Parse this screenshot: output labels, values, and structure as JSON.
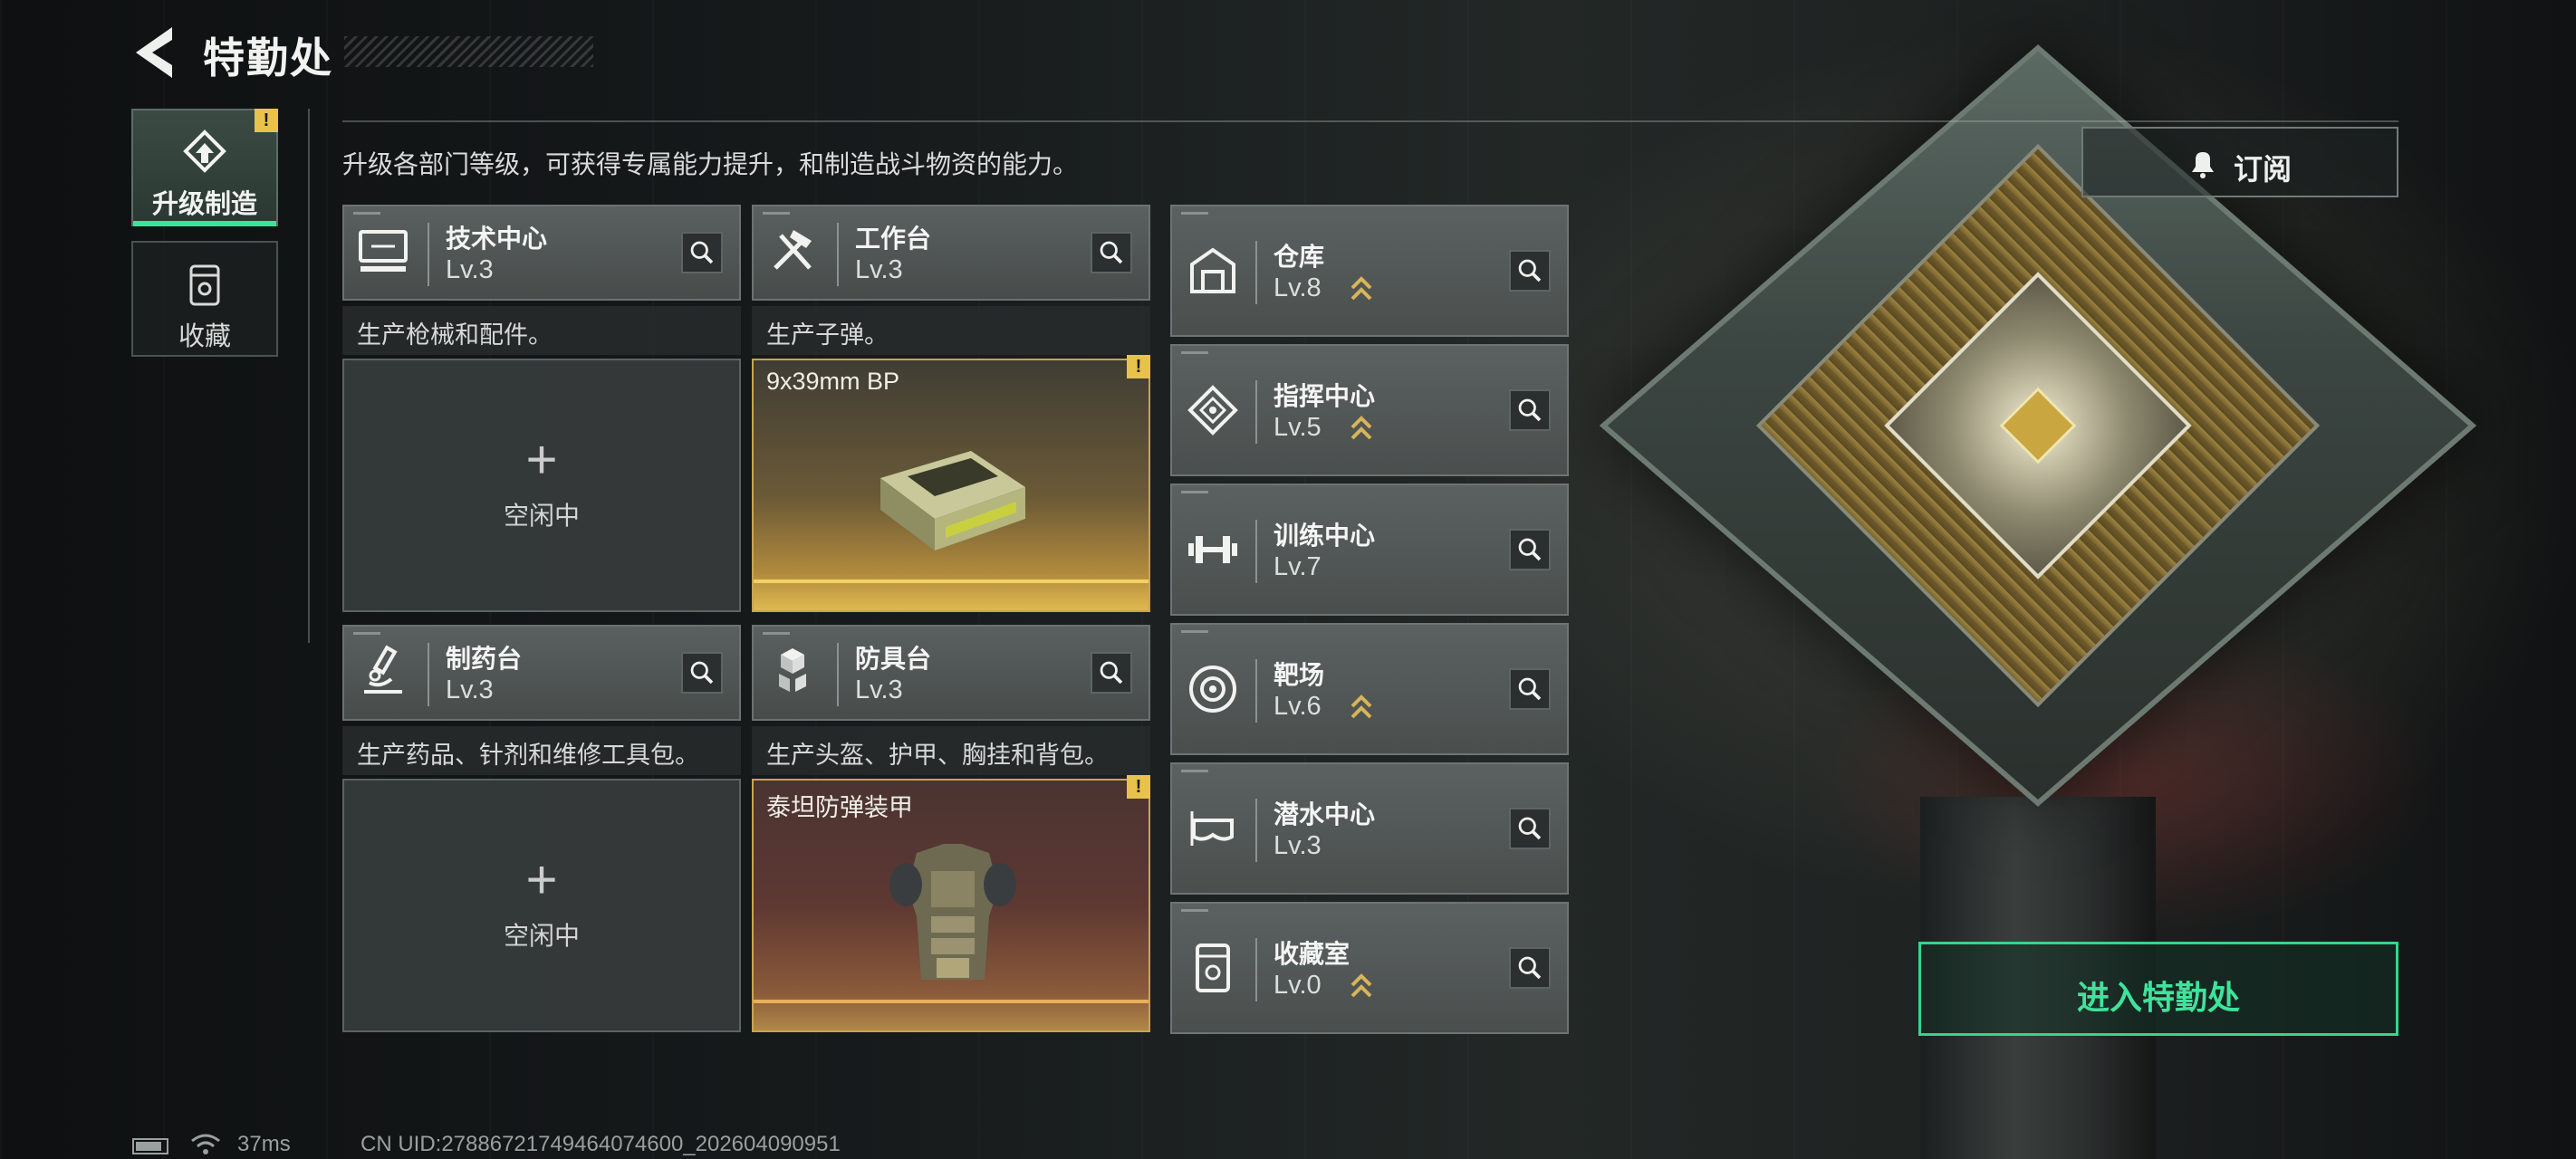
{
  "header": {
    "title": "特勤处"
  },
  "tabs": [
    {
      "label": "升级制造",
      "badge": "!",
      "active": true
    },
    {
      "label": "收藏",
      "active": false
    }
  ],
  "description": "升级各部门等级，可获得专属能力提升，和制造战斗物资的能力。",
  "facilities": [
    {
      "name": "技术中心",
      "level": "Lv.3",
      "desc": "生产枪械和配件。",
      "slot_status": "空闲中",
      "slot_plus": "+"
    },
    {
      "name": "工作台",
      "level": "Lv.3",
      "desc": "生产子弹。",
      "slot_item": "9x39mm BP",
      "badge": "!"
    },
    {
      "name": "制药台",
      "level": "Lv.3",
      "desc": "生产药品、针剂和维修工具包。",
      "slot_status": "空闲中",
      "slot_plus": "+"
    },
    {
      "name": "防具台",
      "level": "Lv.3",
      "desc": "生产头盔、护甲、胸挂和背包。",
      "slot_item": "泰坦防弹装甲",
      "badge": "!"
    }
  ],
  "departments": [
    {
      "name": "仓库",
      "level": "Lv.8",
      "upgradeable": true
    },
    {
      "name": "指挥中心",
      "level": "Lv.5",
      "upgradeable": true
    },
    {
      "name": "训练中心",
      "level": "Lv.7",
      "upgradeable": false
    },
    {
      "name": "靶场",
      "level": "Lv.6",
      "upgradeable": true
    },
    {
      "name": "潜水中心",
      "level": "Lv.3",
      "upgradeable": false
    },
    {
      "name": "收藏室",
      "level": "Lv.0",
      "upgradeable": true
    }
  ],
  "subscribe": {
    "label": "订阅"
  },
  "enter_button": {
    "label": "进入特勤处"
  },
  "status_bar": {
    "ping": "37ms",
    "uid": "CN UID:2788672174946407460​0_202604090951"
  },
  "colors": {
    "accent": "#3fe39b",
    "badge": "#e8c24a",
    "upgrade_arrow": "#d8b45a"
  }
}
